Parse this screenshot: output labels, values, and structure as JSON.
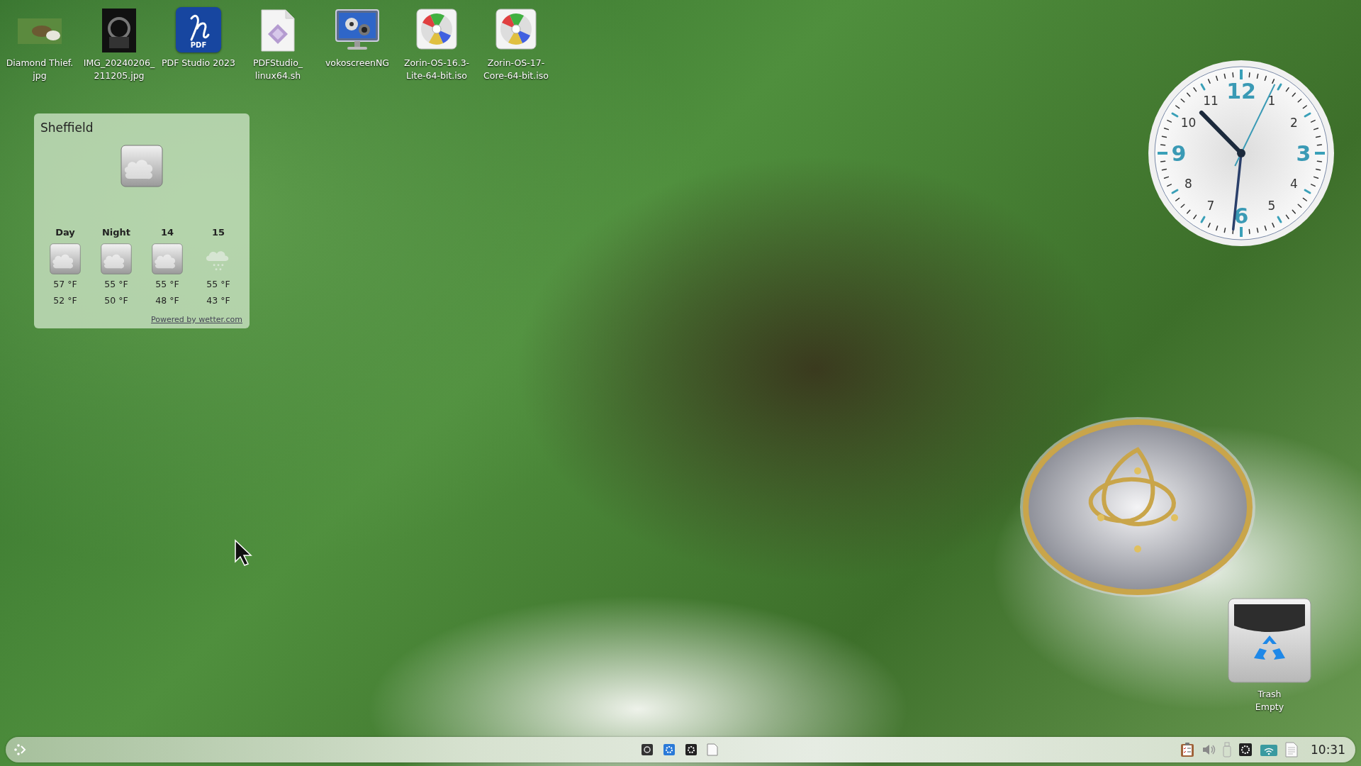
{
  "desktop_icons": [
    {
      "kind": "photo",
      "label": "Diamond Thief.\njpg"
    },
    {
      "kind": "photo-dark",
      "label": "IMG_20240206_\n211205.jpg"
    },
    {
      "kind": "pdf-app",
      "badge": "PDF",
      "label": "PDF Studio 2023"
    },
    {
      "kind": "script",
      "label": "PDFStudio_\nlinux64.sh"
    },
    {
      "kind": "recorder",
      "label": "vokoscreenNG"
    },
    {
      "kind": "disc",
      "label": "Zorin-OS-16.3-\nLite-64-bit.iso"
    },
    {
      "kind": "disc",
      "label": "Zorin-OS-17-\nCore-64-bit.iso"
    }
  ],
  "weather": {
    "city": "Sheffield",
    "current": {
      "kind": "cloudy"
    },
    "forecast": [
      {
        "label": "Day",
        "kind": "cloudy",
        "high": "57 °F",
        "low": "52 °F"
      },
      {
        "label": "Night",
        "kind": "cloudy",
        "high": "55 °F",
        "low": "50 °F"
      },
      {
        "label": "14",
        "kind": "cloudy",
        "high": "55 °F",
        "low": "48 °F"
      },
      {
        "label": "15",
        "kind": "rain",
        "high": "55 °F",
        "low": "43 °F"
      }
    ],
    "credit": "Powered by wetter.com"
  },
  "clock": {
    "numerals": [
      "12",
      "1",
      "2",
      "3",
      "4",
      "5",
      "6",
      "7",
      "8",
      "9",
      "10",
      "11"
    ]
  },
  "trash": {
    "label": "Trash\nEmpty"
  },
  "taskbar": {
    "tasks": [
      {
        "kind": "screenshot"
      },
      {
        "kind": "kde"
      },
      {
        "kind": "recorder"
      },
      {
        "kind": "document"
      }
    ],
    "tray": [
      {
        "kind": "clipboard"
      },
      {
        "kind": "volume"
      },
      {
        "kind": "usb"
      },
      {
        "kind": "kde-dark"
      },
      {
        "kind": "wifi"
      },
      {
        "kind": "notes"
      }
    ],
    "time": "10:31"
  }
}
